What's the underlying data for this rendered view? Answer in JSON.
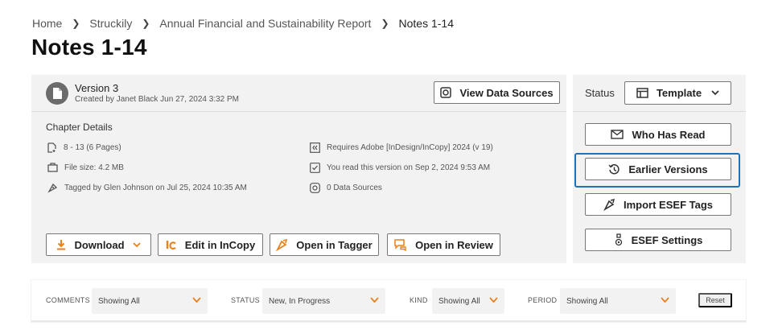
{
  "breadcrumb": [
    "Home",
    "Struckily",
    "Annual Financial and Sustainability Report",
    "Notes 1-14"
  ],
  "page_title": "Notes 1-14",
  "version": {
    "title": "Version 3",
    "subtitle": "Created by Janet Black Jun 27, 2024 3:32 PM",
    "view_sources_label": "View Data Sources"
  },
  "chapter": {
    "heading": "Chapter Details",
    "pages": "8 - 13 (6 Pages)",
    "file_size": "File size: 4.2 MB",
    "tagged_by": "Tagged by Glen Johnson on Jul 25, 2024 10:35 AM",
    "requires": "Requires Adobe [InDesign/InCopy] 2024 (v 19)",
    "read_status": "You read this version on Sep 2, 2024 9:53 AM",
    "data_sources": "0 Data Sources"
  },
  "actions": {
    "download": "Download",
    "edit_incopy": "Edit in InCopy",
    "open_tagger": "Open in Tagger",
    "open_review": "Open in Review"
  },
  "side": {
    "status_label": "Status",
    "status_value": "Template",
    "who_has_read": "Who Has Read",
    "earlier_versions": "Earlier Versions",
    "import_esef": "Import ESEF Tags",
    "esef_settings": "ESEF Settings"
  },
  "filters": {
    "comments_label": "COMMENTS",
    "comments_value": "Showing All",
    "status_label": "STATUS",
    "status_value": "New, In Progress",
    "kind_label": "KIND",
    "kind_value": "Showing All",
    "period_label": "PERIOD",
    "period_value": "Showing All",
    "reset": "Reset"
  },
  "colors": {
    "accent_orange": "#e8821e",
    "focus_blue": "#1f72b8",
    "panel_bg": "#f2f2f2"
  },
  "icons": [
    "chevron-right-icon",
    "document-icon",
    "data-sources-icon",
    "page-range-icon",
    "briefcase-icon",
    "tag-icon",
    "incopy-icon",
    "check-square-icon",
    "data-sources-small-icon",
    "download-icon",
    "chevron-down-icon",
    "tagger-icon",
    "review-icon",
    "template-icon",
    "mail-read-icon",
    "history-icon",
    "esef-settings-icon"
  ]
}
